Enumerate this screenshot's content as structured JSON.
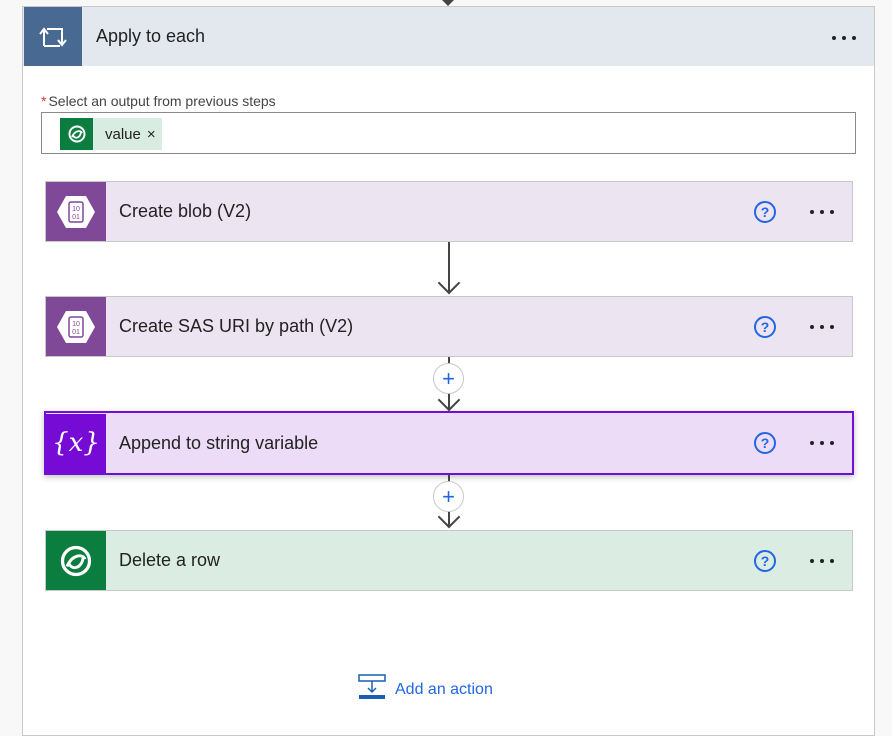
{
  "scope": {
    "title": "Apply to each",
    "icon": "loop-icon",
    "more_label": "More options"
  },
  "input": {
    "required_marker": "*",
    "label": "Select an output from previous steps",
    "token": {
      "icon": "dataverse-icon",
      "text": "value",
      "remove": "×"
    }
  },
  "actions": [
    {
      "title": "Create blob (V2)",
      "icon": "azure-blob-icon",
      "color": "#804998",
      "help": "?"
    },
    {
      "title": "Create SAS URI by path (V2)",
      "icon": "azure-blob-icon",
      "color": "#804998",
      "help": "?"
    },
    {
      "title": "Append to string variable",
      "icon": "variable-icon",
      "icon_text": "{x}",
      "color": "#770bd6",
      "help": "?",
      "selected": true
    },
    {
      "title": "Delete a row",
      "icon": "dataverse-icon",
      "color": "#0b7d3f",
      "help": "?"
    }
  ],
  "add_action": {
    "label": "Add an action"
  },
  "colors": {
    "scope_header": "#486991",
    "link": "#2266e3"
  }
}
